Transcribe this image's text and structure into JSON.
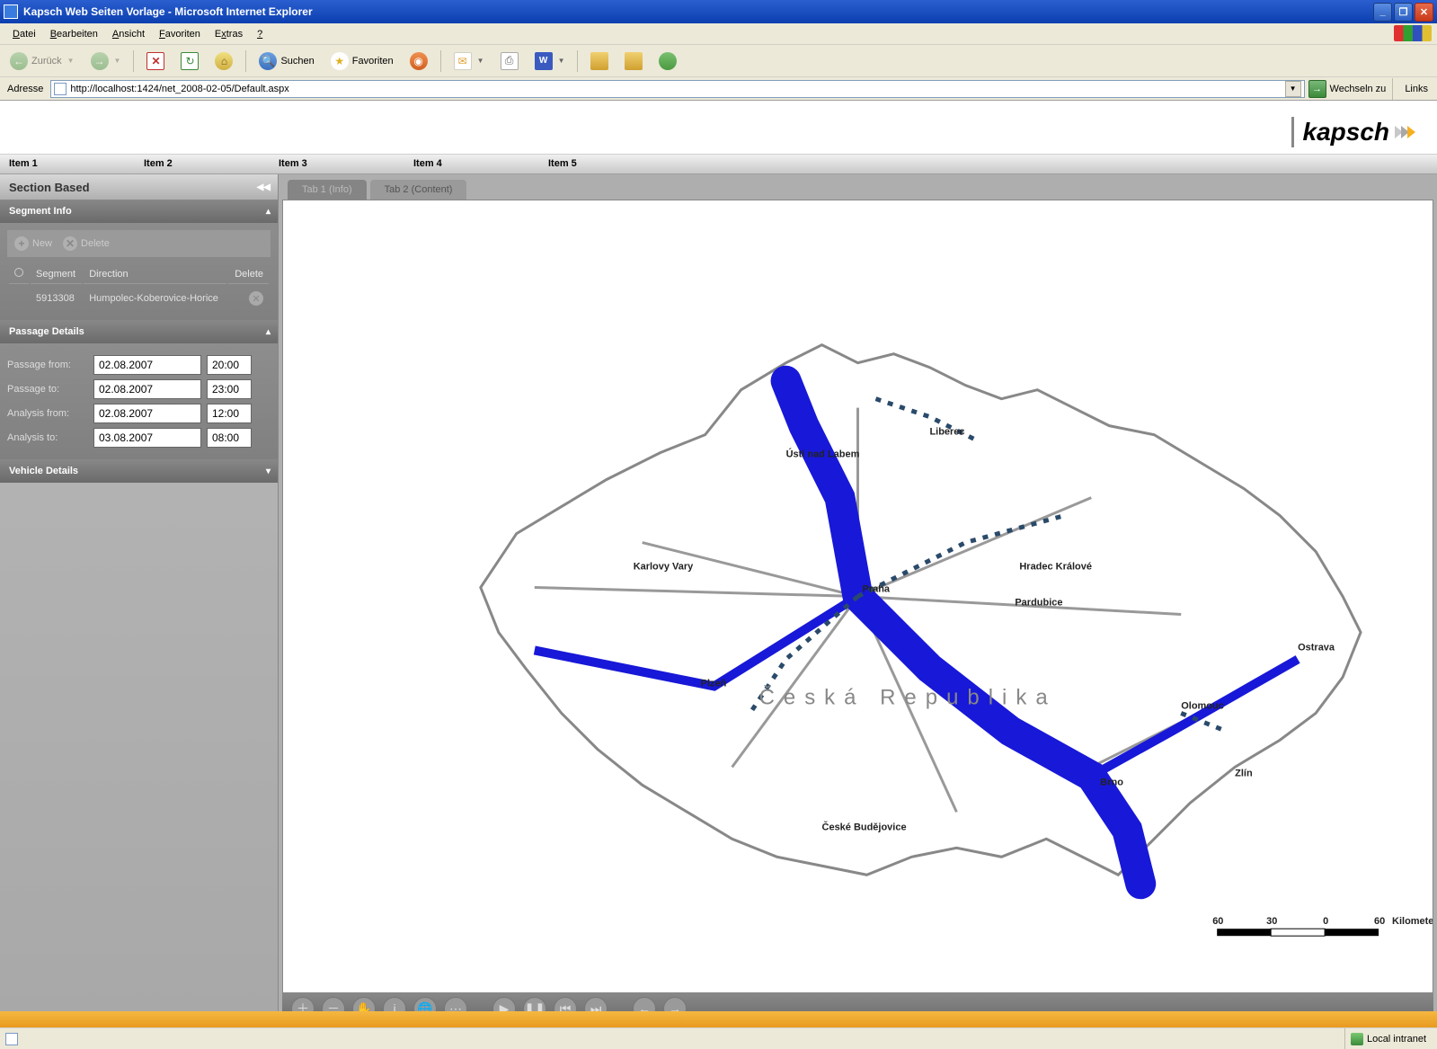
{
  "window": {
    "title": "Kapsch Web Seiten Vorlage - Microsoft Internet Explorer"
  },
  "menu": {
    "items": [
      "Datei",
      "Bearbeiten",
      "Ansicht",
      "Favoriten",
      "Extras",
      "?"
    ]
  },
  "toolbar": {
    "back": "Zurück",
    "search": "Suchen",
    "favorites": "Favoriten"
  },
  "address": {
    "label": "Adresse",
    "url": "http://localhost:1424/net_2008-02-05/Default.aspx",
    "go": "Wechseln zu",
    "links": "Links"
  },
  "logo": {
    "text": "kapsch"
  },
  "topnav": {
    "items": [
      "Item 1",
      "Item 2",
      "Item 3",
      "Item 4",
      "Item 5"
    ]
  },
  "sidebar": {
    "title": "Section Based",
    "segment_info": {
      "title": "Segment Info",
      "new": "New",
      "delete": "Delete",
      "columns": {
        "segment": "Segment",
        "direction": "Direction",
        "delete": "Delete"
      },
      "rows": [
        {
          "segment": "5913308",
          "direction": "Humpolec-Koberovice-Horice"
        }
      ]
    },
    "passage_details": {
      "title": "Passage Details",
      "rows": [
        {
          "label": "Passage from:",
          "date": "02.08.2007",
          "time": "20:00"
        },
        {
          "label": "Passage to:",
          "date": "02.08.2007",
          "time": "23:00"
        },
        {
          "label": "Analysis from:",
          "date": "02.08.2007",
          "time": "12:00"
        },
        {
          "label": "Analysis to:",
          "date": "03.08.2007",
          "time": "08:00"
        }
      ]
    },
    "vehicle_details": {
      "title": "Vehicle Details"
    }
  },
  "tabs": {
    "items": [
      "Tab 1 (Info)",
      "Tab 2 (Content)"
    ]
  },
  "map": {
    "country": "Česká Republika",
    "cities": [
      "Praha",
      "Brno",
      "Ostrava",
      "Plzeň",
      "Liberec",
      "Olomouc",
      "Ústí nad Labem",
      "Hradec Králové",
      "Pardubice",
      "České Budějovice",
      "Karlovy Vary",
      "Zlín"
    ],
    "scale": {
      "ticks": [
        "60",
        "30",
        "0",
        "60"
      ],
      "unit": "Kilometers"
    }
  },
  "status": {
    "zone": "Local intranet"
  }
}
